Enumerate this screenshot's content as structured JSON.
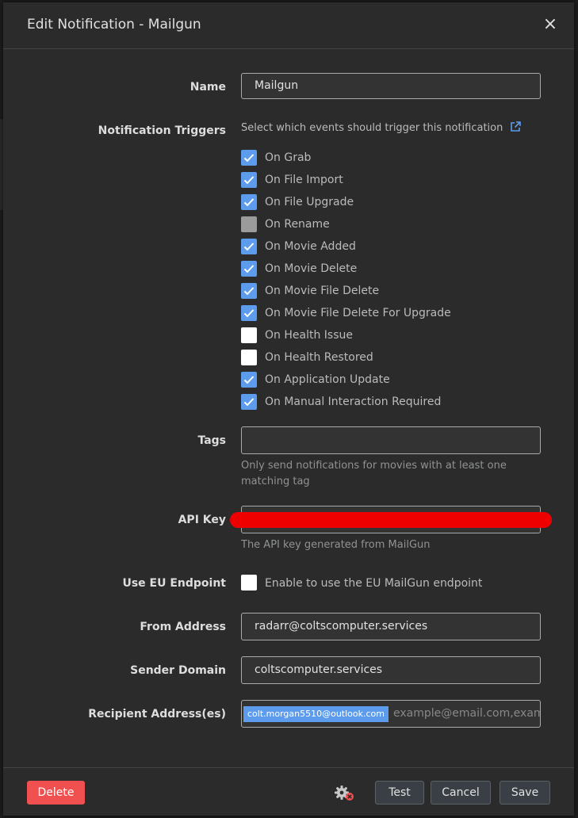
{
  "modal": {
    "title": "Edit Notification - Mailgun",
    "close_icon": "×"
  },
  "name": {
    "label": "Name",
    "value": "Mailgun"
  },
  "triggers": {
    "label": "Notification Triggers",
    "hint": "Select which events should trigger this notification",
    "items": [
      {
        "label": "On Grab",
        "state": "checked"
      },
      {
        "label": "On File Import",
        "state": "checked"
      },
      {
        "label": "On File Upgrade",
        "state": "checked"
      },
      {
        "label": "On Rename",
        "state": "disabled"
      },
      {
        "label": "On Movie Added",
        "state": "checked"
      },
      {
        "label": "On Movie Delete",
        "state": "checked"
      },
      {
        "label": "On Movie File Delete",
        "state": "checked"
      },
      {
        "label": "On Movie File Delete For Upgrade",
        "state": "checked"
      },
      {
        "label": "On Health Issue",
        "state": "unchecked"
      },
      {
        "label": "On Health Restored",
        "state": "unchecked"
      },
      {
        "label": "On Application Update",
        "state": "checked"
      },
      {
        "label": "On Manual Interaction Required",
        "state": "checked"
      }
    ]
  },
  "tags": {
    "label": "Tags",
    "value": "",
    "help": "Only send notifications for movies with at least one matching tag"
  },
  "api_key": {
    "label": "API Key",
    "help": "The API key generated from MailGun"
  },
  "eu_endpoint": {
    "label": "Use EU Endpoint",
    "checkbox_label": "Enable to use the EU MailGun endpoint"
  },
  "from_address": {
    "label": "From Address",
    "value": "radarr@coltscomputer.services"
  },
  "sender_domain": {
    "label": "Sender Domain",
    "value": "coltscomputer.services"
  },
  "recipients": {
    "label": "Recipient Address(es)",
    "chip": "colt.morgan5510@outlook.com",
    "placeholder": "example@email.com,examp"
  },
  "footer": {
    "delete": "Delete",
    "test": "Test",
    "cancel": "Cancel",
    "save": "Save"
  },
  "colors": {
    "accent": "#5d9cec",
    "danger": "#f05050",
    "redaction": "#e00000"
  }
}
